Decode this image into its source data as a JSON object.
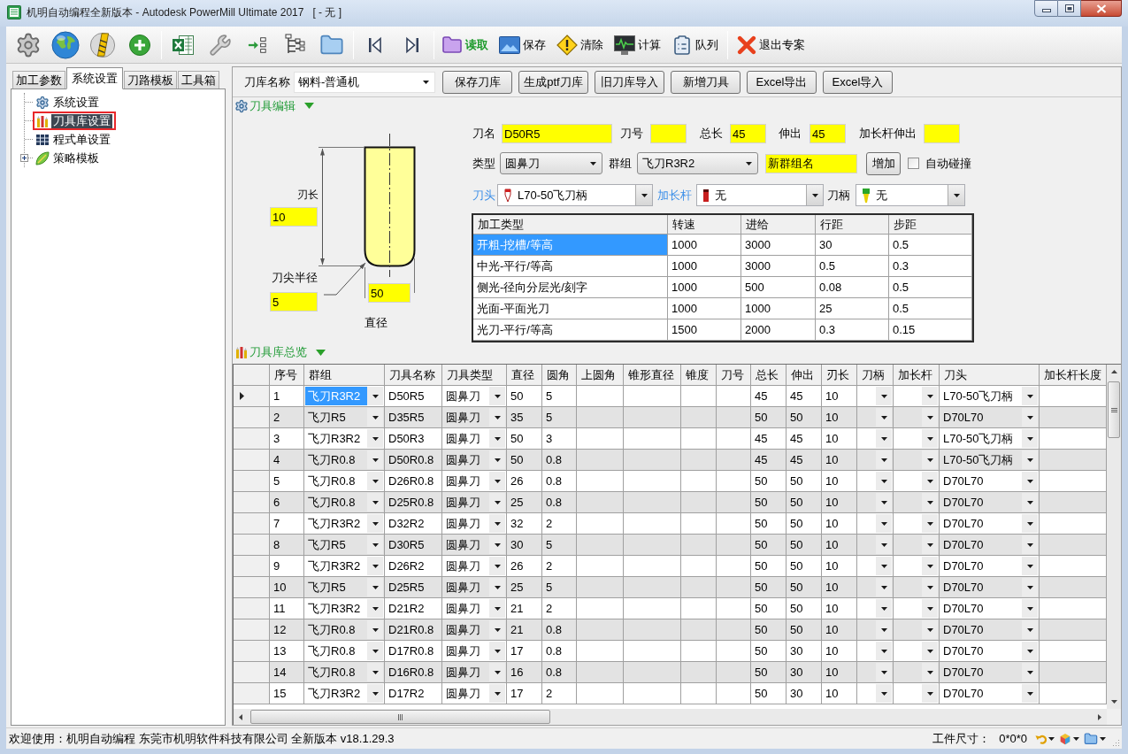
{
  "window": {
    "title": "机明自动编程全新版本 - Autodesk PowerMill Ultimate 2017   [ - 无 ]"
  },
  "toolbar": {
    "actions": [
      {
        "label": "读取",
        "emphasized": true
      },
      {
        "label": "保存",
        "emphasized": false
      },
      {
        "label": "清除",
        "emphasized": false
      },
      {
        "label": "计算",
        "emphasized": false
      },
      {
        "label": "队列",
        "emphasized": false
      },
      {
        "label": "退出专案",
        "emphasized": false
      }
    ]
  },
  "side_tabs": [
    {
      "label": "加工参数",
      "selected": false
    },
    {
      "label": "系统设置",
      "selected": true
    },
    {
      "label": "刀路模板",
      "selected": false
    },
    {
      "label": "工具箱",
      "selected": false
    }
  ],
  "tree": [
    {
      "label": "系统设置",
      "kind": "leaf",
      "selected": false,
      "marked": false
    },
    {
      "label": "刀具库设置",
      "kind": "leaf",
      "selected": true,
      "marked": true
    },
    {
      "label": "程式单设置",
      "kind": "leaf",
      "selected": false,
      "marked": false
    },
    {
      "label": "策略模板",
      "kind": "folder",
      "expanded": false,
      "selected": false,
      "marked": false
    }
  ],
  "library": {
    "label": "刀库名称",
    "value": "钢料-普通机",
    "buttons": [
      "保存刀库",
      "生成ptf刀库",
      "旧刀库导入",
      "新增刀具",
      "Excel导出",
      "Excel导入"
    ]
  },
  "tool_edit": {
    "title": "刀具编辑",
    "expanded": true,
    "diagram": {
      "flute_length_label": "刃长",
      "flute_length": "10",
      "corner_radius_label": "刀尖半径",
      "corner_radius": "5",
      "diameter_label": "直径",
      "diameter": "50"
    },
    "fields": [
      {
        "label": "刀名",
        "value": "D50R5"
      },
      {
        "label": "刀号"
      },
      {
        "label": "总长",
        "value": "45"
      },
      {
        "label": "伸出",
        "value": "45"
      },
      {
        "label": "加长杆伸出"
      }
    ],
    "type": {
      "label": "类型",
      "value": "圆鼻刀"
    },
    "group": {
      "label": "群组",
      "value": "飞刀R3R2"
    },
    "new_group": {
      "value": "新群组名"
    },
    "add_button": "增加",
    "auto_collision": {
      "label": "自动碰撞",
      "checked": false
    },
    "holders": [
      {
        "label": "刀头",
        "value": "L70-50飞刀柄",
        "link": true
      },
      {
        "label": "加长杆",
        "value": "无",
        "link": true
      },
      {
        "label": "刀柄",
        "value": "无",
        "link": false
      }
    ],
    "machining_table": {
      "columns": [
        "加工类型",
        "转速",
        "进给",
        "行距",
        "步距"
      ],
      "rows": [
        {
          "cells": [
            "开粗-挖槽/等高",
            "1000",
            "3000",
            "30",
            "0.5"
          ],
          "selected": true
        },
        {
          "cells": [
            "中光-平行/等高",
            "1000",
            "3000",
            "0.5",
            "0.3"
          ],
          "selected": false
        },
        {
          "cells": [
            "侧光-径向分层光/刻字",
            "1000",
            "500",
            "0.08",
            "0.5"
          ],
          "selected": false
        },
        {
          "cells": [
            "光面-平面光刀",
            "1000",
            "1000",
            "25",
            "0.5"
          ],
          "selected": false
        },
        {
          "cells": [
            "光刀-平行/等高",
            "1500",
            "2000",
            "0.3",
            "0.15"
          ],
          "selected": false
        }
      ]
    }
  },
  "overview": {
    "title": "刀具库总览",
    "expanded": true
  },
  "tool_table": {
    "columns": [
      {
        "label": "序号",
        "kind": "text"
      },
      {
        "label": "群组",
        "kind": "dropdown"
      },
      {
        "label": "刀具名称",
        "kind": "text"
      },
      {
        "label": "刀具类型",
        "kind": "dropdown"
      },
      {
        "label": "直径",
        "kind": "text"
      },
      {
        "label": "圆角",
        "kind": "text"
      },
      {
        "label": "上圆角",
        "kind": "text"
      },
      {
        "label": "锥形直径",
        "kind": "text"
      },
      {
        "label": "锥度",
        "kind": "text"
      },
      {
        "label": "刀号",
        "kind": "text"
      },
      {
        "label": "总长",
        "kind": "text"
      },
      {
        "label": "伸出",
        "kind": "text"
      },
      {
        "label": "刃长",
        "kind": "text"
      },
      {
        "label": "刀柄",
        "kind": "dropdown"
      },
      {
        "label": "加长杆",
        "kind": "dropdown"
      },
      {
        "label": "刀头",
        "kind": "dropdown"
      },
      {
        "label": "加长杆长度",
        "kind": "text"
      }
    ],
    "rows": [
      {
        "selected": true,
        "cells": [
          "1",
          "飞刀R3R2",
          "D50R5",
          "圆鼻刀",
          "50",
          "5",
          null,
          null,
          null,
          null,
          "45",
          "45",
          "10",
          null,
          null,
          "L70-50飞刀柄",
          null
        ]
      },
      {
        "selected": false,
        "cells": [
          "2",
          "飞刀R5",
          "D35R5",
          "圆鼻刀",
          "35",
          "5",
          null,
          null,
          null,
          null,
          "50",
          "50",
          "10",
          null,
          null,
          "D70L70",
          null
        ]
      },
      {
        "selected": false,
        "cells": [
          "3",
          "飞刀R3R2",
          "D50R3",
          "圆鼻刀",
          "50",
          "3",
          null,
          null,
          null,
          null,
          "45",
          "45",
          "10",
          null,
          null,
          "L70-50飞刀柄",
          null
        ]
      },
      {
        "selected": false,
        "cells": [
          "4",
          "飞刀R0.8",
          "D50R0.8",
          "圆鼻刀",
          "50",
          "0.8",
          null,
          null,
          null,
          null,
          "45",
          "45",
          "10",
          null,
          null,
          "L70-50飞刀柄",
          null
        ]
      },
      {
        "selected": false,
        "cells": [
          "5",
          "飞刀R0.8",
          "D26R0.8",
          "圆鼻刀",
          "26",
          "0.8",
          null,
          null,
          null,
          null,
          "50",
          "50",
          "10",
          null,
          null,
          "D70L70",
          null
        ]
      },
      {
        "selected": false,
        "cells": [
          "6",
          "飞刀R0.8",
          "D25R0.8",
          "圆鼻刀",
          "25",
          "0.8",
          null,
          null,
          null,
          null,
          "50",
          "50",
          "10",
          null,
          null,
          "D70L70",
          null
        ]
      },
      {
        "selected": false,
        "cells": [
          "7",
          "飞刀R3R2",
          "D32R2",
          "圆鼻刀",
          "32",
          "2",
          null,
          null,
          null,
          null,
          "50",
          "50",
          "10",
          null,
          null,
          "D70L70",
          null
        ]
      },
      {
        "selected": false,
        "cells": [
          "8",
          "飞刀R5",
          "D30R5",
          "圆鼻刀",
          "30",
          "5",
          null,
          null,
          null,
          null,
          "50",
          "50",
          "10",
          null,
          null,
          "D70L70",
          null
        ]
      },
      {
        "selected": false,
        "cells": [
          "9",
          "飞刀R3R2",
          "D26R2",
          "圆鼻刀",
          "26",
          "2",
          null,
          null,
          null,
          null,
          "50",
          "50",
          "10",
          null,
          null,
          "D70L70",
          null
        ]
      },
      {
        "selected": false,
        "cells": [
          "10",
          "飞刀R5",
          "D25R5",
          "圆鼻刀",
          "25",
          "5",
          null,
          null,
          null,
          null,
          "50",
          "50",
          "10",
          null,
          null,
          "D70L70",
          null
        ]
      },
      {
        "selected": false,
        "cells": [
          "11",
          "飞刀R3R2",
          "D21R2",
          "圆鼻刀",
          "21",
          "2",
          null,
          null,
          null,
          null,
          "50",
          "50",
          "10",
          null,
          null,
          "D70L70",
          null
        ]
      },
      {
        "selected": false,
        "cells": [
          "12",
          "飞刀R0.8",
          "D21R0.8",
          "圆鼻刀",
          "21",
          "0.8",
          null,
          null,
          null,
          null,
          "50",
          "50",
          "10",
          null,
          null,
          "D70L70",
          null
        ]
      },
      {
        "selected": false,
        "cells": [
          "13",
          "飞刀R0.8",
          "D17R0.8",
          "圆鼻刀",
          "17",
          "0.8",
          null,
          null,
          null,
          null,
          "50",
          "30",
          "10",
          null,
          null,
          "D70L70",
          null
        ]
      },
      {
        "selected": false,
        "cells": [
          "14",
          "飞刀R0.8",
          "D16R0.8",
          "圆鼻刀",
          "16",
          "0.8",
          null,
          null,
          null,
          null,
          "50",
          "30",
          "10",
          null,
          null,
          "D70L70",
          null
        ]
      },
      {
        "selected": false,
        "cells": [
          "15",
          "飞刀R3R2",
          "D17R2",
          "圆鼻刀",
          "17",
          "2",
          null,
          null,
          null,
          null,
          "50",
          "30",
          "10",
          null,
          null,
          "D70L70",
          null
        ]
      }
    ]
  },
  "status_bar": {
    "message": "欢迎使用：机明自动编程 东莞市机明软件科技有限公司 全新版本 v18.1.29.3",
    "size_label": "工件尺寸：",
    "size_value": "0*0*0"
  }
}
